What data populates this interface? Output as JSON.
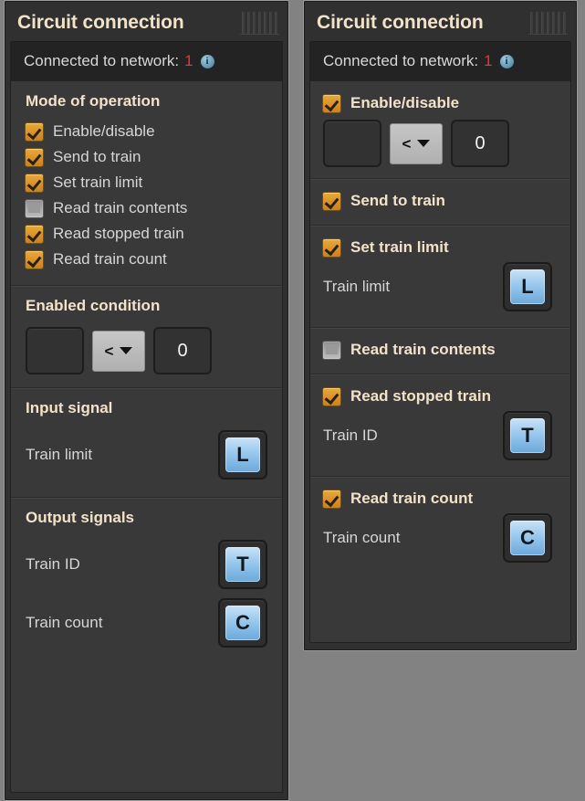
{
  "left_panel": {
    "title": "Circuit connection",
    "drag_handle_bars": 7,
    "status": {
      "label": "Connected to network:",
      "value": "1",
      "info_glyph": "i"
    },
    "mode_section": {
      "title": "Mode of operation",
      "options": [
        {
          "label": "Enable/disable",
          "checked": true
        },
        {
          "label": "Send to train",
          "checked": true
        },
        {
          "label": "Set train limit",
          "checked": true
        },
        {
          "label": "Read train contents",
          "checked": false
        },
        {
          "label": "Read stopped train",
          "checked": true
        },
        {
          "label": "Read train count",
          "checked": true
        }
      ]
    },
    "enabled_condition": {
      "title": "Enabled condition",
      "first_operand": "",
      "operator": "<",
      "second_operand": "0"
    },
    "input_signal": {
      "title": "Input signal",
      "rows": [
        {
          "label": "Train limit",
          "glyph": "L"
        }
      ]
    },
    "output_signals": {
      "title": "Output signals",
      "rows": [
        {
          "label": "Train ID",
          "glyph": "T"
        },
        {
          "label": "Train count",
          "glyph": "C"
        }
      ]
    }
  },
  "right_panel": {
    "title": "Circuit connection",
    "drag_handle_bars": 7,
    "status": {
      "label": "Connected to network:",
      "value": "1",
      "info_glyph": "i"
    },
    "sections": [
      {
        "name": "enable-disable",
        "checkbox": {
          "label": "Enable/disable",
          "checked": true
        },
        "condition": {
          "first_operand": "",
          "operator": "<",
          "second_operand": "0"
        }
      },
      {
        "name": "send-to-train",
        "checkbox": {
          "label": "Send to train",
          "checked": true
        }
      },
      {
        "name": "set-train-limit",
        "checkbox": {
          "label": "Set train limit",
          "checked": true
        },
        "signal": {
          "label": "Train limit",
          "glyph": "L"
        }
      },
      {
        "name": "read-train-contents",
        "checkbox": {
          "label": "Read train contents",
          "checked": false
        }
      },
      {
        "name": "read-stopped-train",
        "checkbox": {
          "label": "Read stopped train",
          "checked": true
        },
        "signal": {
          "label": "Train ID",
          "glyph": "T"
        }
      },
      {
        "name": "read-train-count",
        "checkbox": {
          "label": "Read train count",
          "checked": true
        },
        "signal": {
          "label": "Train count",
          "glyph": "C"
        }
      }
    ]
  },
  "colors": {
    "background": "#828282",
    "window_bg": "#313031",
    "content_bg": "#3a393a",
    "status_bg": "#242324",
    "title_text": "#f2e3c8",
    "body_text": "#d6d6d6",
    "network_value": "#e03a3a",
    "checkbox_on": "#d9922a",
    "checkbox_off": "#a6a6a6",
    "signal_glyph": "#9dcbee",
    "dropdown_bg": "#bdbdbd"
  }
}
